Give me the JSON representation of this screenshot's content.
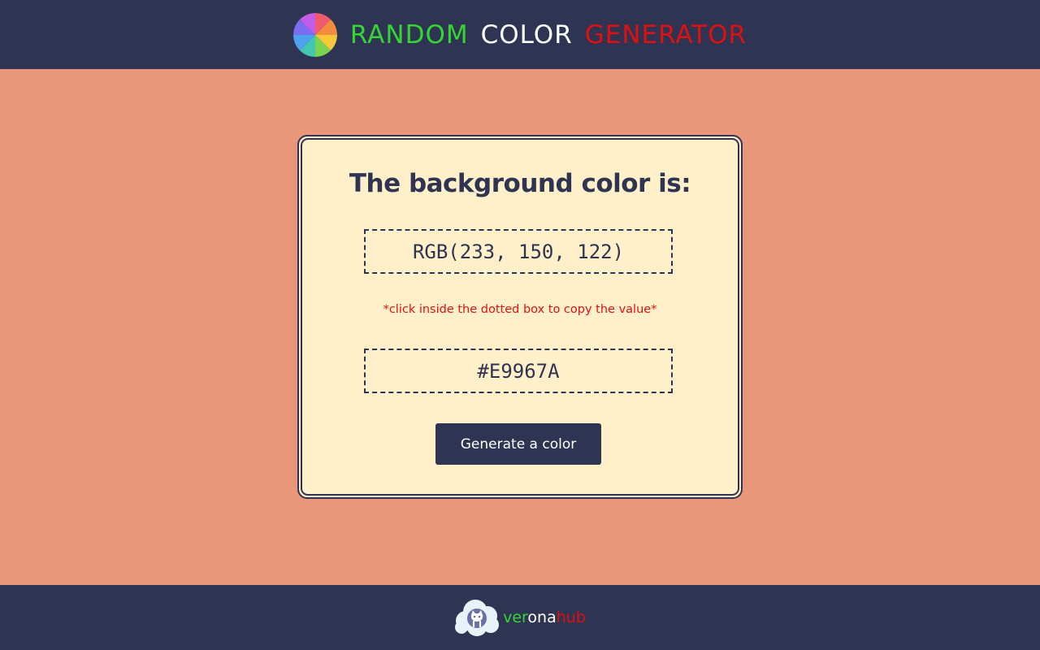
{
  "header": {
    "title_words": [
      "RANDOM",
      "COLOR",
      "GENERATOR"
    ],
    "title_colors": [
      "#33d633",
      "#ffffff",
      "#e01010"
    ],
    "logo_icon": "color-wheel-icon",
    "background": "#2f3452"
  },
  "main": {
    "background": "#e9967a",
    "heading": "The background color is:",
    "rgb_value": "RGB(233, 150, 122)",
    "copy_hint": "*click inside the dotted box to copy the value*",
    "hex_value": "#E9967A",
    "generate_label": "Generate a color",
    "card_background": "#fff0c9"
  },
  "footer": {
    "logo_icon": "github-cloud-icon",
    "brand_parts": [
      "ver",
      "ona",
      "hub"
    ],
    "brand_colors": [
      "#33d633",
      "#ffffff",
      "#e01010"
    ],
    "background": "#2f3452"
  }
}
